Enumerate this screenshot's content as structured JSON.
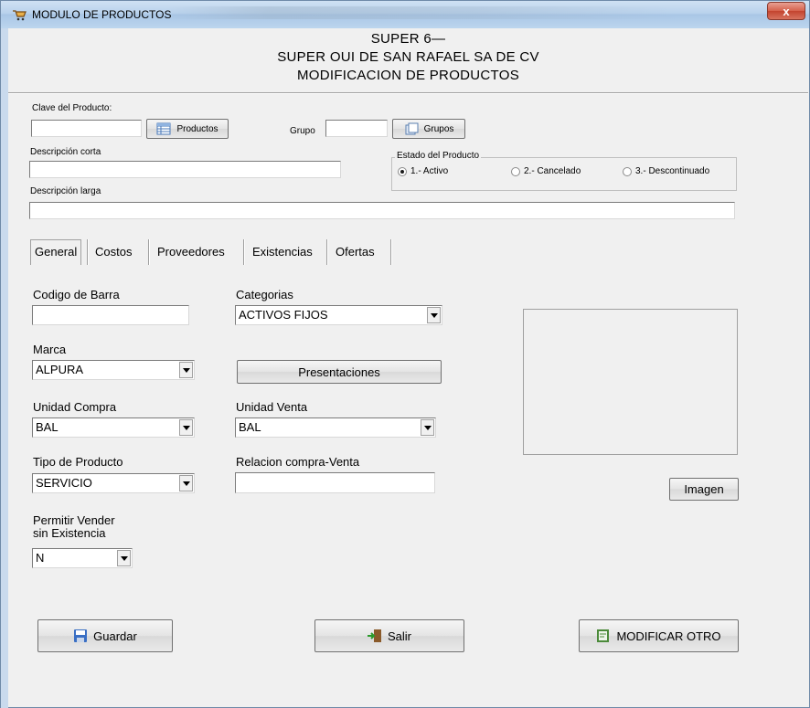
{
  "window": {
    "title": "MODULO DE PRODUCTOS",
    "close_label": "x"
  },
  "header": {
    "line1": "SUPER 6—",
    "line2": "SUPER OUI DE SAN RAFAEL SA DE CV",
    "line3": "MODIFICACION DE PRODUCTOS"
  },
  "form": {
    "clave_label": "Clave del Producto:",
    "clave_value": "",
    "productos_button": "Productos",
    "grupo_label": "Grupo",
    "grupo_value": "",
    "grupos_button": "Grupos",
    "desc_corta_label": "Descripción corta",
    "desc_corta_value": "",
    "desc_larga_label": "Descripción larga",
    "desc_larga_value": "",
    "estado": {
      "title": "Estado del Producto",
      "options": [
        "1.- Activo",
        "2.- Cancelado",
        "3.- Descontinuado"
      ],
      "selected": "1.- Activo"
    }
  },
  "tabs": [
    "General",
    "Costos",
    "Proveedores",
    "Existencias",
    "Ofertas"
  ],
  "active_tab": "General",
  "general": {
    "codigo_barra_label": "Codigo de Barra",
    "codigo_barra_value": "",
    "categorias_label": "Categorias",
    "categorias_value": "ACTIVOS FIJOS",
    "marca_label": "Marca",
    "marca_value": "ALPURA",
    "presentaciones_button": "Presentaciones",
    "unidad_compra_label": "Unidad Compra",
    "unidad_compra_value": "BAL",
    "unidad_venta_label": "Unidad Venta",
    "unidad_venta_value": "BAL",
    "tipo_producto_label": "Tipo de Producto",
    "tipo_producto_value": "SERVICIO",
    "relacion_label": "Relacion compra-Venta",
    "relacion_value": "",
    "permitir_label_1": "Permitir Vender",
    "permitir_label_2": "sin Existencia",
    "permitir_value": "N",
    "imagen_button": "Imagen"
  },
  "actions": {
    "guardar": "Guardar",
    "salir": "Salir",
    "modificar_otro": "MODIFICAR OTRO"
  },
  "icons": {
    "app": "cart-icon",
    "productos": "grid-icon",
    "grupos": "pages-icon",
    "guardar": "floppy-icon",
    "salir": "exit-door-icon",
    "modificar": "edit-form-icon"
  },
  "colors": {
    "titlebar": "#b9d2ec",
    "close": "#c3442f",
    "window_bg": "#f0f0f0"
  }
}
